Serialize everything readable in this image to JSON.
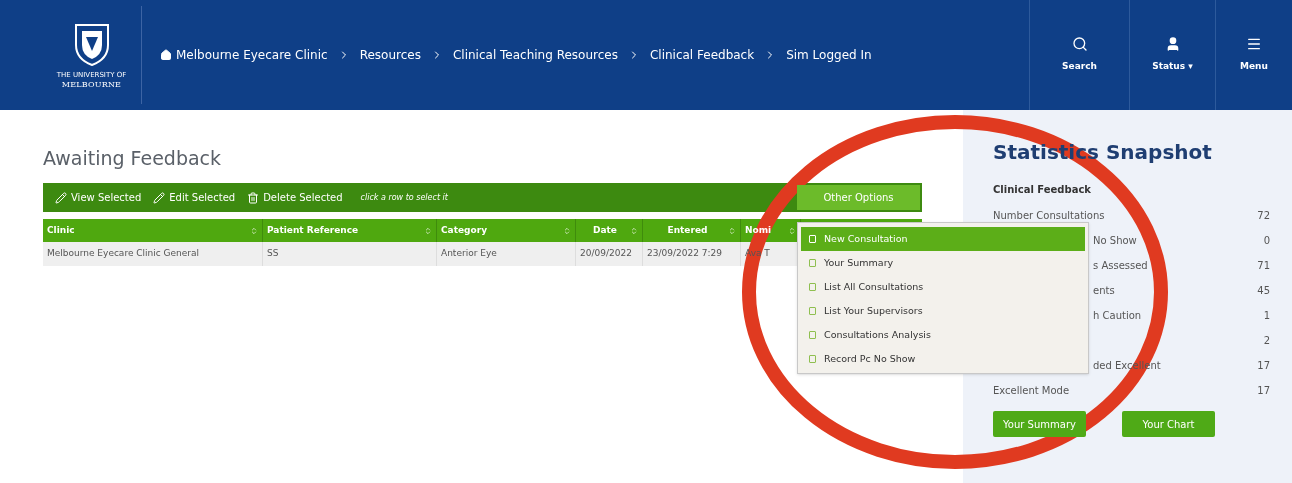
{
  "header": {
    "logo_lines": [
      "THE UNIVERSITY OF",
      "MELBOURNE"
    ],
    "breadcrumbs": [
      {
        "label": "Melbourne Eyecare Clinic",
        "kind": "home"
      },
      {
        "label": "Resources",
        "kind": "link"
      },
      {
        "label": "Clinical Teaching Resources",
        "kind": "link"
      },
      {
        "label": "Clinical Feedback",
        "kind": "link"
      },
      {
        "label": "Sim Logged In",
        "kind": "link"
      }
    ],
    "actions": [
      {
        "label": "Search",
        "kind": "search"
      },
      {
        "label": "Status ▾",
        "kind": "user"
      },
      {
        "label": "Menu",
        "kind": "menu"
      }
    ]
  },
  "main": {
    "title": "Awaiting Feedback",
    "toolbar": {
      "buttons": [
        {
          "label": "View Selected",
          "kind": "view"
        },
        {
          "label": "Edit Selected",
          "kind": "edit"
        },
        {
          "label": "Delete Selected",
          "kind": "delete"
        }
      ],
      "hint": "click a row to select it",
      "other_options": "Other Options"
    },
    "table": {
      "columns": [
        "Clinic",
        "Patient Reference",
        "Category",
        "Date",
        "Entered",
        "Nomi"
      ],
      "rows": [
        [
          "Melbourne Eyecare Clinic General",
          "SS",
          "Anterior Eye",
          "20/09/2022",
          "23/09/2022 7:29",
          "Ava T"
        ]
      ]
    },
    "dropdown": [
      {
        "label": "New Consultation",
        "selected": true
      },
      {
        "label": "Your Summary",
        "selected": false
      },
      {
        "label": "List All Consultations",
        "selected": false
      },
      {
        "label": "List Your Supervisors",
        "selected": false
      },
      {
        "label": "Consultations Analysis",
        "selected": false
      },
      {
        "label": "Record Pc No Show",
        "selected": false
      }
    ]
  },
  "stats": {
    "title": "Statistics Snapshot",
    "section": "Clinical Feedback",
    "rows": [
      {
        "label": "Number Consultations",
        "kind": "full",
        "value": "72"
      },
      {
        "label": "No Show",
        "kind": "partial",
        "value": "0"
      },
      {
        "label": "s Assessed",
        "kind": "partial",
        "value": "71"
      },
      {
        "label": "ents",
        "kind": "partial",
        "value": "45"
      },
      {
        "label": "h Caution",
        "kind": "partial",
        "value": "1"
      },
      {
        "kind": "hidden",
        "value": "2"
      },
      {
        "label": "ded Excellent",
        "kind": "partial",
        "value": "17"
      },
      {
        "label": "Excellent Mode",
        "kind": "full",
        "value": "17"
      }
    ],
    "buttons": [
      "Your Summary",
      "Your Chart"
    ]
  }
}
